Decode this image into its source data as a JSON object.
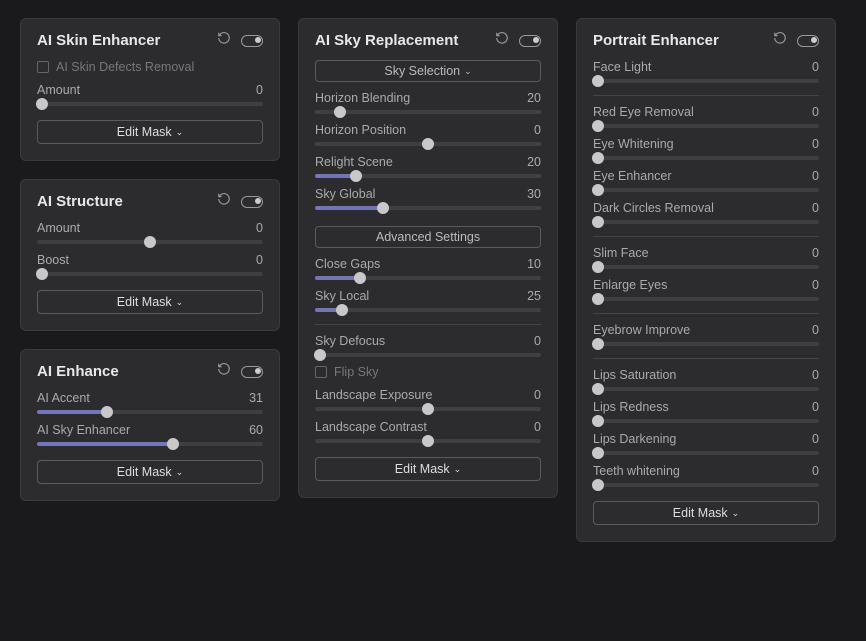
{
  "col1": {
    "skin": {
      "title": "AI Skin Enhancer",
      "defects_label": "AI Skin Defects Removal",
      "sliders": [
        {
          "label": "Amount",
          "val": "0",
          "pct": 2
        }
      ],
      "mask": "Edit Mask"
    },
    "structure": {
      "title": "AI Structure",
      "sliders": [
        {
          "label": "Amount",
          "val": "0",
          "pct": 50
        },
        {
          "label": "Boost",
          "val": "0",
          "pct": 2
        }
      ],
      "mask": "Edit Mask"
    },
    "enhance": {
      "title": "AI Enhance",
      "sliders": [
        {
          "label": "AI Accent",
          "val": "31",
          "pct": 31,
          "fill": true
        },
        {
          "label": "AI Sky Enhancer",
          "val": "60",
          "pct": 60,
          "fill": true
        }
      ],
      "mask": "Edit Mask"
    }
  },
  "col2": {
    "sky": {
      "title": "AI Sky Replacement",
      "sky_sel": "Sky Selection",
      "g1": [
        {
          "label": "Horizon Blending",
          "val": "20",
          "pct": 11
        },
        {
          "label": "Horizon Position",
          "val": "0",
          "pct": 50
        },
        {
          "label": "Relight Scene",
          "val": "20",
          "pct": 18,
          "fill": true
        },
        {
          "label": "Sky Global",
          "val": "30",
          "pct": 30,
          "fill": true
        }
      ],
      "adv": "Advanced Settings",
      "g2": [
        {
          "label": "Close Gaps",
          "val": "10",
          "pct": 20,
          "fill": true
        },
        {
          "label": "Sky Local",
          "val": "25",
          "pct": 12,
          "fill": true
        }
      ],
      "g3": [
        {
          "label": "Sky Defocus",
          "val": "0",
          "pct": 2
        }
      ],
      "flip": "Flip Sky",
      "g4": [
        {
          "label": "Landscape Exposure",
          "val": "0",
          "pct": 50
        },
        {
          "label": "Landscape Contrast",
          "val": "0",
          "pct": 50
        }
      ],
      "mask": "Edit Mask"
    }
  },
  "col3": {
    "portrait": {
      "title": "Portrait Enhancer",
      "g1": [
        {
          "label": "Face Light",
          "val": "0",
          "pct": 2
        }
      ],
      "g2": [
        {
          "label": "Red Eye Removal",
          "val": "0",
          "pct": 2
        },
        {
          "label": "Eye Whitening",
          "val": "0",
          "pct": 2
        },
        {
          "label": "Eye Enhancer",
          "val": "0",
          "pct": 2
        },
        {
          "label": "Dark Circles Removal",
          "val": "0",
          "pct": 2
        }
      ],
      "g3": [
        {
          "label": "Slim Face",
          "val": "0",
          "pct": 2
        },
        {
          "label": "Enlarge Eyes",
          "val": "0",
          "pct": 2
        }
      ],
      "g4": [
        {
          "label": "Eyebrow Improve",
          "val": "0",
          "pct": 2
        }
      ],
      "g5": [
        {
          "label": "Lips Saturation",
          "val": "0",
          "pct": 2
        },
        {
          "label": "Lips Redness",
          "val": "0",
          "pct": 2
        },
        {
          "label": "Lips Darkening",
          "val": "0",
          "pct": 2
        },
        {
          "label": "Teeth whitening",
          "val": "0",
          "pct": 2
        }
      ],
      "mask": "Edit Mask"
    }
  }
}
